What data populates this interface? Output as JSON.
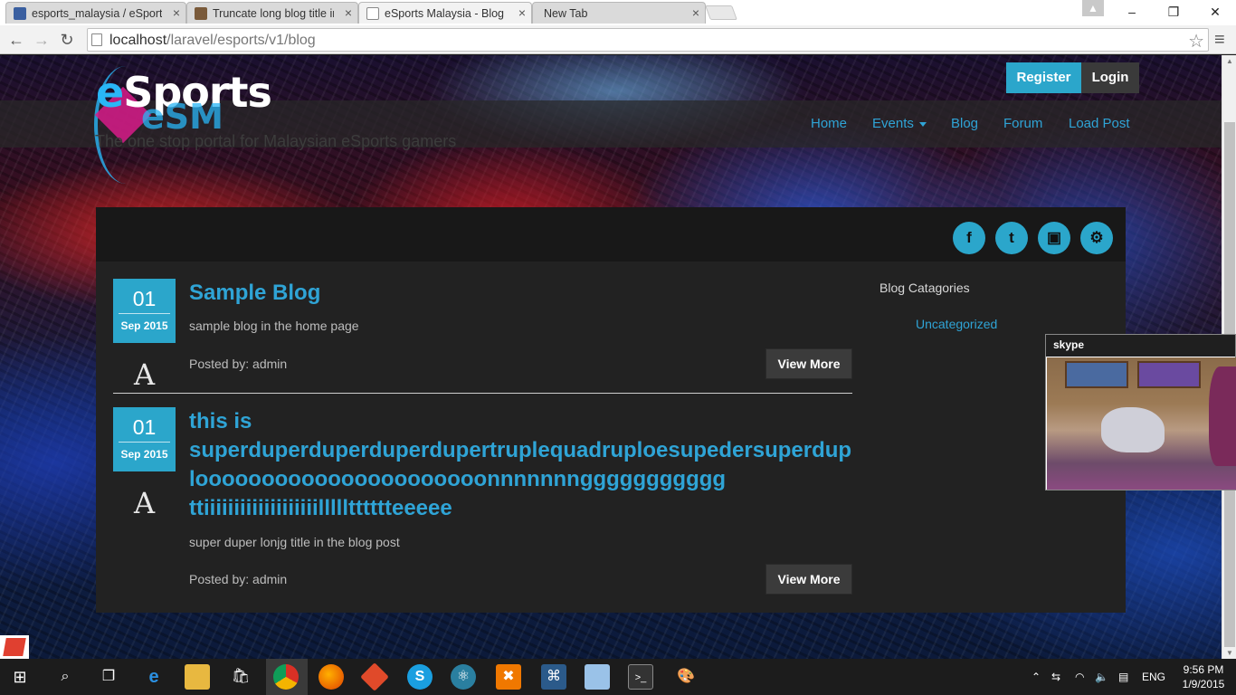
{
  "browser": {
    "tabs": [
      {
        "title": "esports_malaysia / eSport",
        "favicon_color": "#3a5fa0"
      },
      {
        "title": "Truncate long blog title in",
        "favicon_color": "#7a5a3a"
      },
      {
        "title": "eSports Malaysia - Blog",
        "favicon_color": "#ffffff"
      },
      {
        "title": "New Tab",
        "favicon_color": "#dadada"
      }
    ],
    "url_host": "localhost",
    "url_path": "/laravel/esports/v1/blog",
    "window_controls": {
      "minimize": "–",
      "restore": "❐",
      "close": "✕"
    },
    "nav": {
      "back": "←",
      "forward": "→",
      "reload": "↻",
      "star": "☆",
      "menu": "≡"
    }
  },
  "site": {
    "logo_e": "e",
    "logo_rest": "Sports",
    "logo_sub": "eSM",
    "tagline": "The one stop portal for Malaysian eSports gamers",
    "auth": {
      "register": "Register",
      "login": "Login"
    },
    "nav": [
      {
        "label": "Home"
      },
      {
        "label": "Events",
        "has_dropdown": true
      },
      {
        "label": "Blog"
      },
      {
        "label": "Forum"
      },
      {
        "label": "Load Post"
      }
    ],
    "social": [
      {
        "icon": "facebook-icon",
        "glyph": "f"
      },
      {
        "icon": "twitter-icon",
        "glyph": "t"
      },
      {
        "icon": "twitch-icon",
        "glyph": "▣"
      },
      {
        "icon": "steam-icon",
        "glyph": "⚙"
      }
    ],
    "accent": "#2ba6cb"
  },
  "posts": [
    {
      "day": "01",
      "month": "Sep 2015",
      "author_glyph": "A",
      "title_lines": [
        "Sample Blog"
      ],
      "excerpt": "sample blog in the home page",
      "posted_by": "Posted by: admin",
      "button": "View More"
    },
    {
      "day": "01",
      "month": "Sep 2015",
      "author_glyph": "A",
      "title_lines": [
        "this is",
        "superduperduperduperdupertruplequadruploesupedersuperdupe",
        "loooooooooooooooooooooonnnnnnnggggggggggg",
        "ttiiiiiiiiiiiiiiiiiiillllltttttteeeee"
      ],
      "excerpt": "super duper lonjg title in the blog post",
      "posted_by": "Posted by: admin",
      "button": "View More"
    }
  ],
  "sidebar": {
    "title": "Blog Catagories",
    "categories": [
      "Uncategorized"
    ]
  },
  "skype": {
    "label": "skype"
  },
  "taskbar": {
    "lang": "ENG",
    "time": "9:56 PM",
    "date": "1/9/2015"
  }
}
